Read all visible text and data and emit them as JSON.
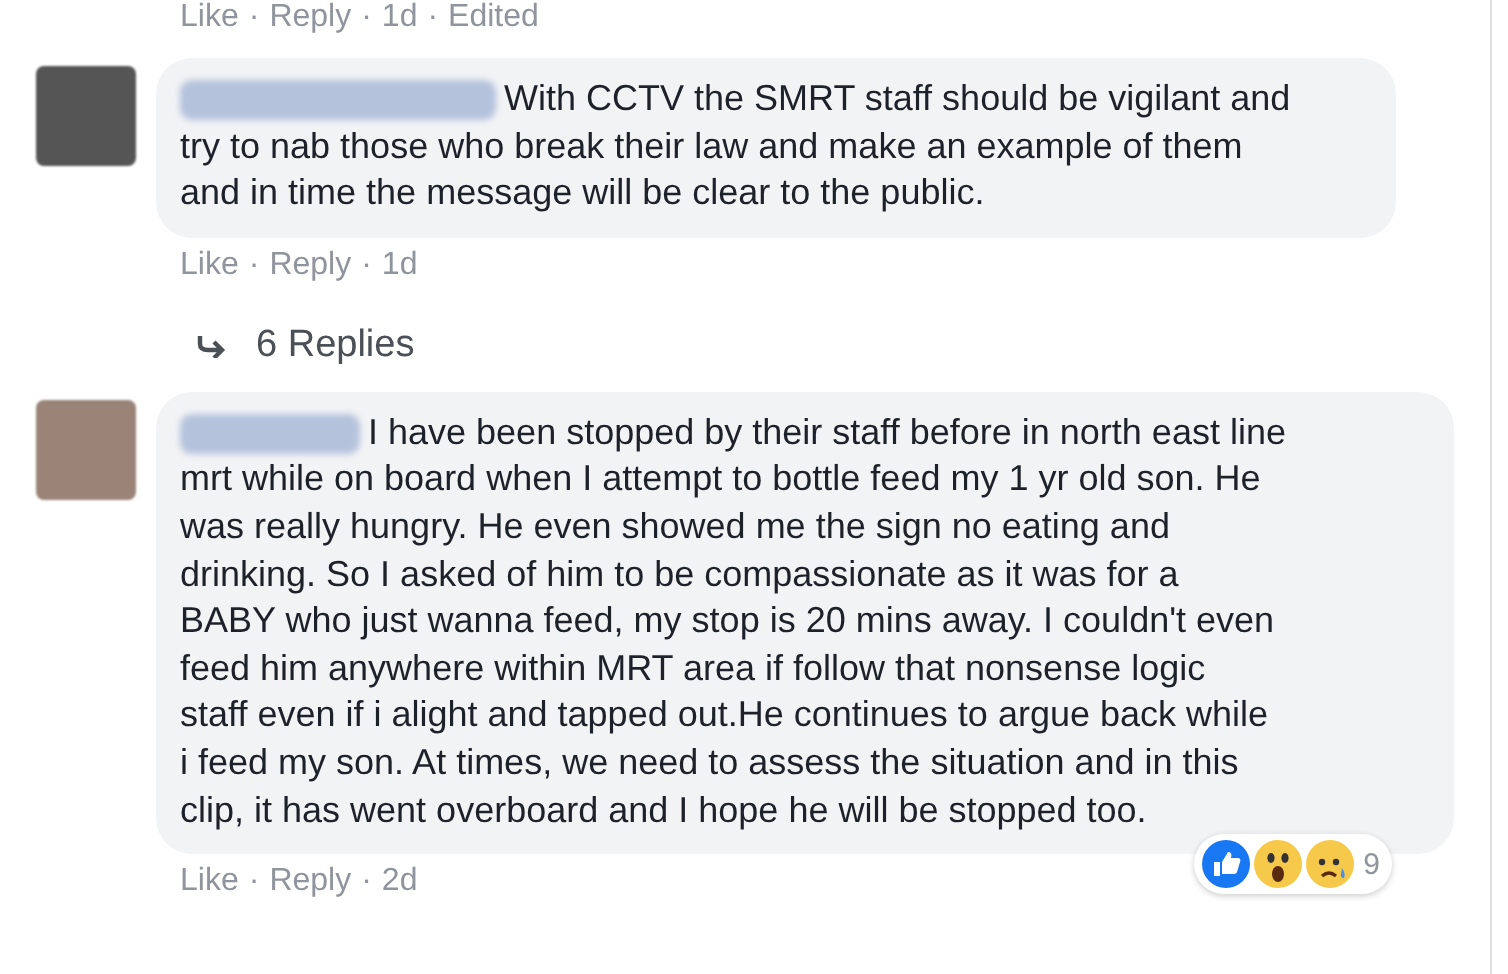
{
  "separator": "·",
  "top_actions": [
    "Like",
    "Reply",
    "1d",
    "Edited"
  ],
  "comments": [
    {
      "lines": [
        "With CCTV the SMRT staff should be vigilant and",
        "try to nab those who break their law and make an example of them",
        "and in time the message will be clear to the public."
      ],
      "actions": [
        "Like",
        "Reply",
        "1d"
      ],
      "replies": "6 Replies"
    },
    {
      "lines": [
        "I have been stopped by their staff before in north east line",
        "mrt while on board when I attempt to bottle feed my 1 yr old son. He",
        "was really hungry. He even showed me the sign no eating and",
        "drinking. So I asked of him to be compassionate as it was for a",
        "BABY who just wanna feed, my stop is 20 mins away. I couldn't even",
        "feed him anywhere within MRT area if follow that nonsense logic",
        "staff even if i alight and tapped out.He continues to argue back while",
        "i feed my son. At times, we need to assess the situation and in this",
        "clip, it has went overboard and I hope he will be stopped too."
      ],
      "actions": [
        "Like",
        "Reply",
        "2d"
      ],
      "reactions": {
        "count": "9"
      }
    }
  ]
}
